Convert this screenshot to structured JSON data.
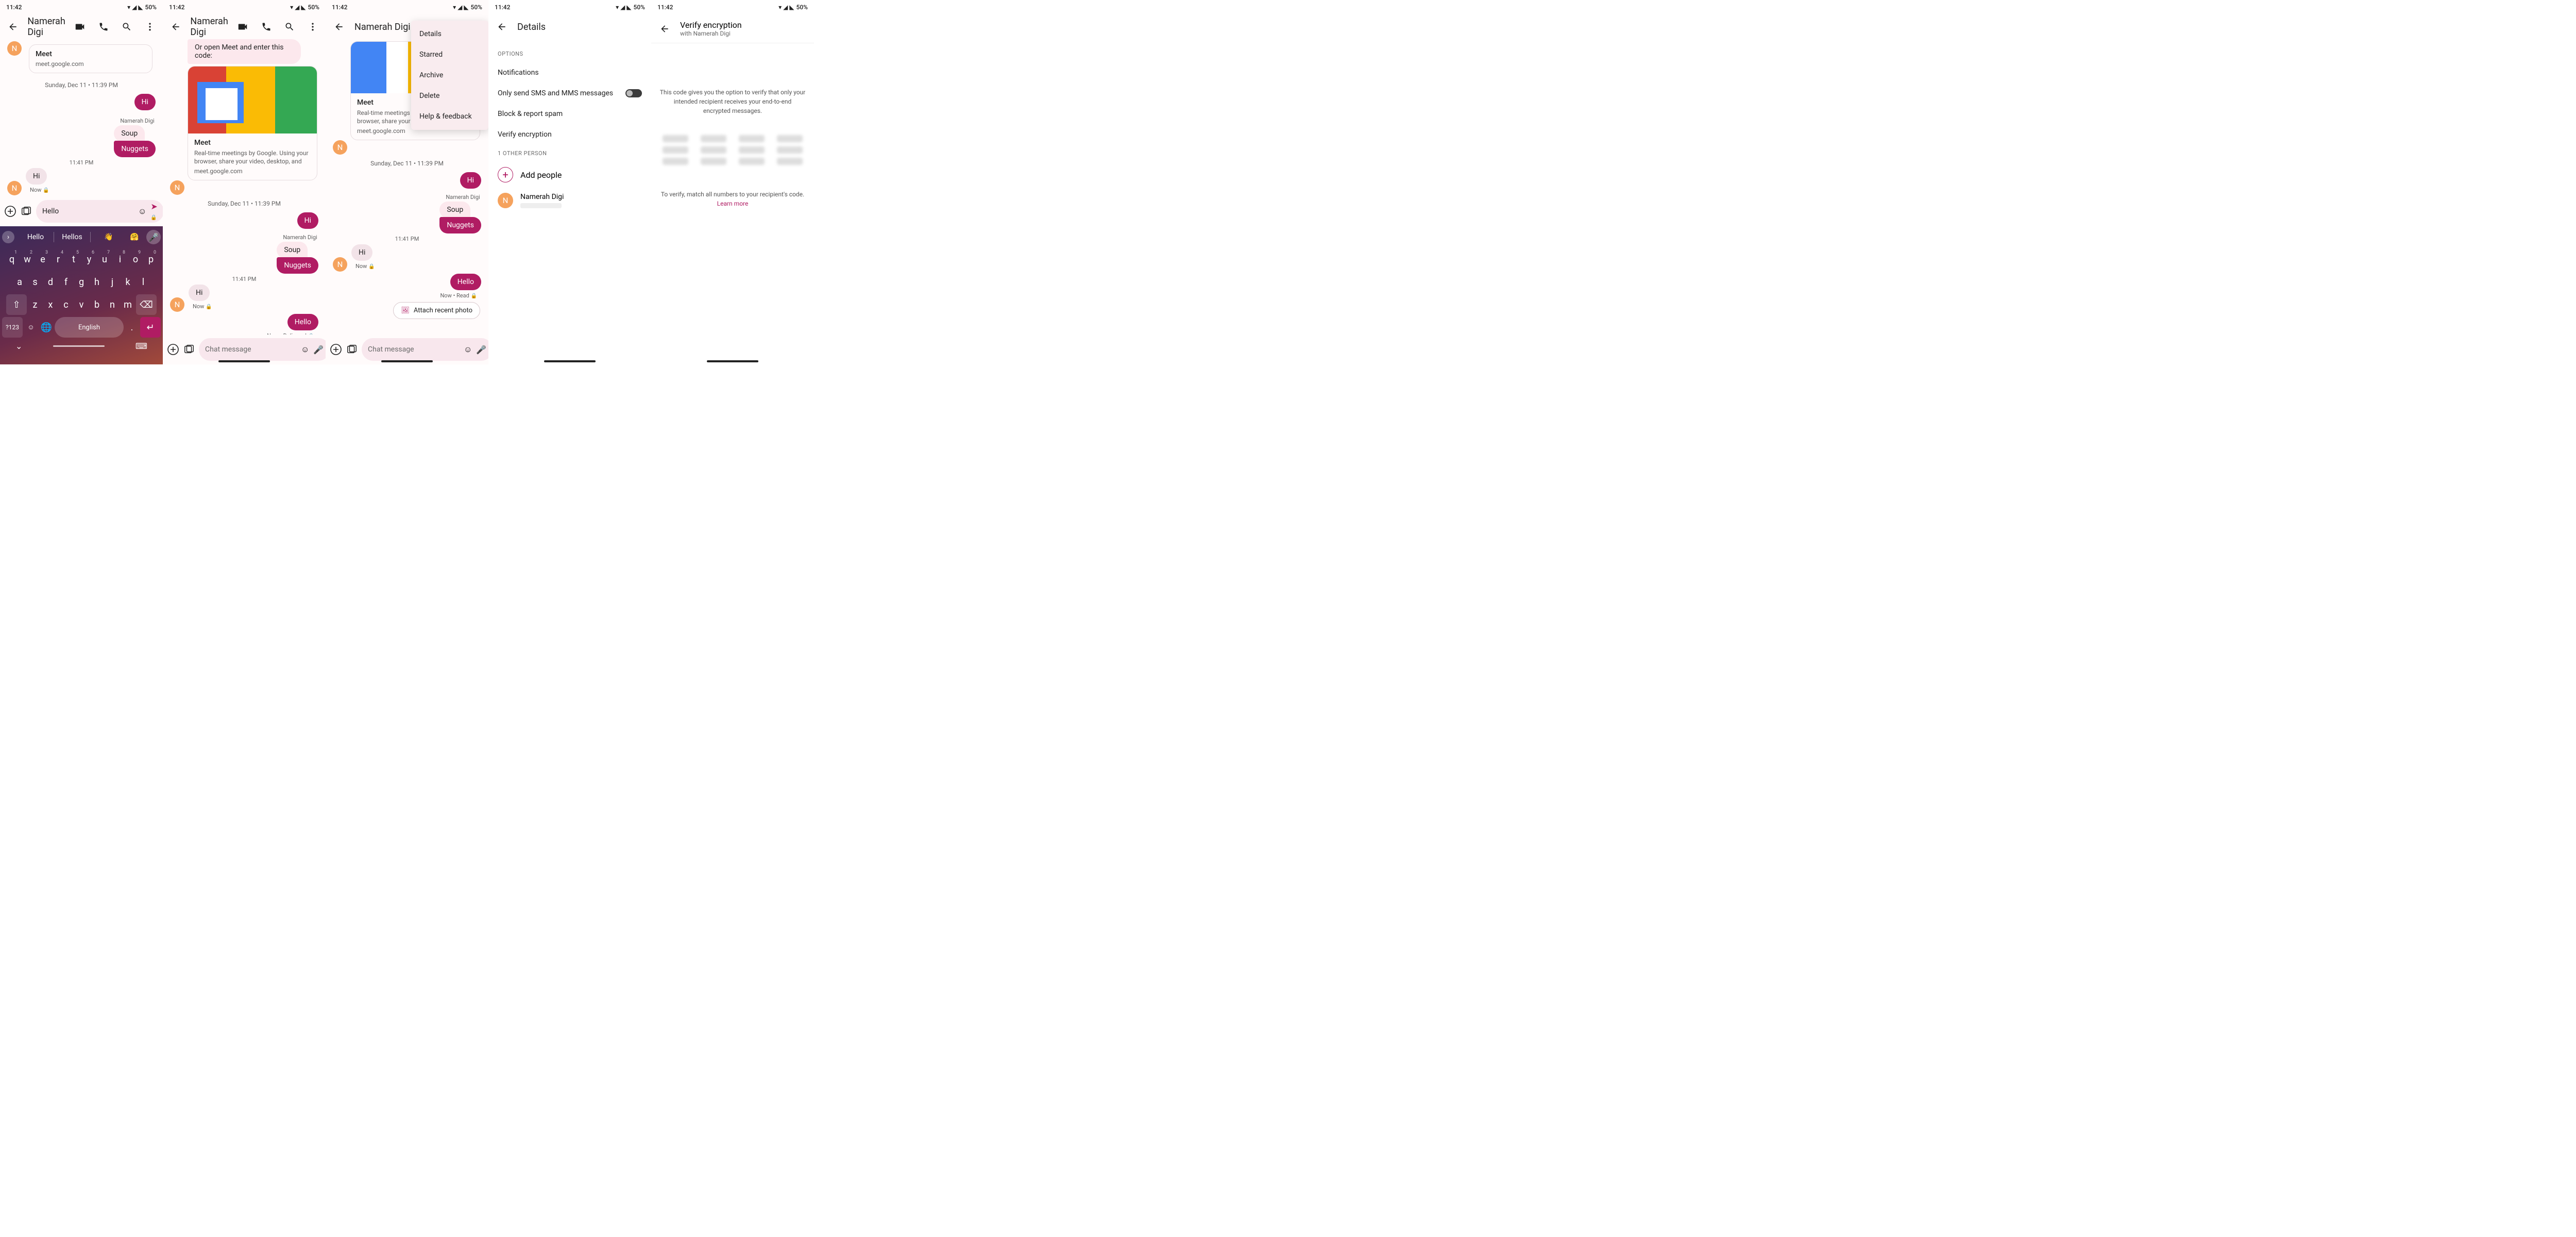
{
  "status": {
    "time": "11:42",
    "battery": "50%"
  },
  "contact": {
    "name": "Namerah Digi",
    "initial": "N"
  },
  "dateSep": "Sunday, Dec 11 • 11:39 PM",
  "ts1141": "11:41 PM",
  "msgs": {
    "hi_out": "Hi",
    "soup": "Soup",
    "nuggets": "Nuggets",
    "hi_in": "Hi",
    "hello": "Hello",
    "now": "Now",
    "nowDelivered": "Now • Delivered",
    "nowRead": "Now • Read"
  },
  "linkcard": {
    "title": "Meet",
    "desc": "Real-time meetings by Google. Using your browser, share your video, desktop, and",
    "desc_cut": "Real-time meetings by Google. Using your browser, share your video",
    "url": "meet.google.com",
    "intro": "Or open Meet and enter this code:"
  },
  "compose": {
    "placeholder": "Chat message",
    "typed": "Hello"
  },
  "menu": {
    "details": "Details",
    "starred": "Starred",
    "archive": "Archive",
    "delete": "Delete",
    "help": "Help & feedback"
  },
  "details": {
    "title": "Details",
    "options": "OPTIONS",
    "notifications": "Notifications",
    "onlysms": "Only send SMS and MMS messages",
    "block": "Block & report spam",
    "verify": "Verify encryption",
    "otherperson": "1 OTHER PERSON",
    "addpeople": "Add people"
  },
  "verify": {
    "title": "Verify encryption",
    "subtitle": "with Namerah Digi",
    "helper": "This code gives you the option to verify that only your intended recipient receives your end-to-end encrypted messages.",
    "match": "To verify, match all numbers to your recipient's code.",
    "learn": "Learn more"
  },
  "kbd": {
    "sug1": "Hello",
    "sug2": "Hellos",
    "lang": "English",
    "sym": "?123"
  },
  "attach": "Attach recent photo"
}
